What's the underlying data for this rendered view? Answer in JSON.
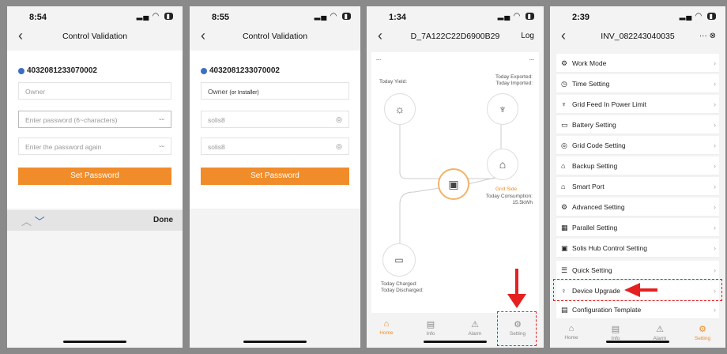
{
  "phone1": {
    "time": "8:54",
    "title": "Control Validation",
    "serial": "4032081233070002",
    "owner": "Owner",
    "pwd1": "Enter password (6~characters)",
    "pwd2": "Enter the password again",
    "button": "Set Password",
    "done": "Done"
  },
  "phone2": {
    "time": "8:55",
    "title": "Control Validation",
    "serial": "4032081233070002",
    "owner": "Owner",
    "owner_hint": "(or Installer)",
    "pwd1": "solis8",
    "pwd2": "solis8",
    "button": "Set Password"
  },
  "phone3": {
    "time": "1:34",
    "title": "D_7A122C22D6900B29",
    "log": "Log",
    "dash_left": "---",
    "dash_right": "---",
    "yield": "Today Yield:",
    "exported": "Today Exported:",
    "imported": "Today Imported:",
    "grid_side": "Grid Side",
    "consumption": "Today Consumption:",
    "consumption_val": "15.5kWh",
    "charged": "Today Charged:",
    "discharged": "Today Discharged:",
    "tabs": [
      "Home",
      "Info",
      "Alarm",
      "Setting"
    ]
  },
  "phone4": {
    "time": "2:39",
    "title": "INV_082243040035",
    "items": [
      "Work Mode",
      "Time Setting",
      "Grid Feed In Power Limit",
      "Battery Setting",
      "Grid Code Setting",
      "Backup Setting",
      "Smart Port",
      "Advanced Setting",
      "Parallel Setting",
      "Solis Hub Control Setting",
      "Quick Setting",
      "Device Upgrade",
      "Configuration Template"
    ],
    "tabs": [
      "Home",
      "Info",
      "Alarm",
      "Setting"
    ]
  },
  "colors": {
    "accent": "#f08c2a",
    "highlight": "#e52020"
  }
}
